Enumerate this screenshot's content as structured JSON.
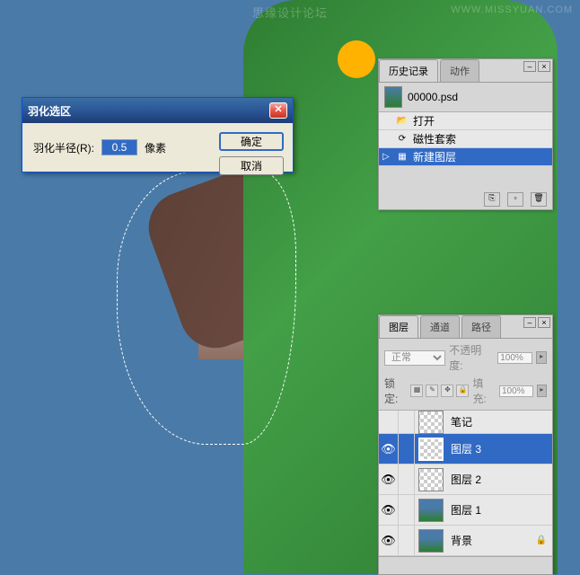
{
  "watermark": {
    "top": "思缘设计论坛",
    "right": "WWW.MISSYUAN.COM"
  },
  "dialog": {
    "title": "羽化选区",
    "label": "羽化半径(R):",
    "value": "0.5",
    "unit": "像素",
    "ok": "确定",
    "cancel": "取消"
  },
  "history": {
    "tab1": "历史记录",
    "tab2": "动作",
    "file": "00000.psd",
    "items": [
      {
        "icon": "📂",
        "label": "打开"
      },
      {
        "icon": "⟳",
        "label": "磁性套索"
      },
      {
        "icon": "▦",
        "label": "新建图层",
        "selected": true
      }
    ]
  },
  "layers": {
    "tab1": "图层",
    "tab2": "通道",
    "tab3": "路径",
    "blend_mode": "正常",
    "opacity_label": "不透明度:",
    "opacity_value": "100%",
    "lock_label": "锁定:",
    "fill_label": "填充:",
    "fill_value": "100%",
    "items": [
      {
        "name": "笔记",
        "visible": false,
        "thumb": "trans"
      },
      {
        "name": "图层 3",
        "visible": true,
        "thumb": "trans",
        "selected": true
      },
      {
        "name": "图层 2",
        "visible": true,
        "thumb": "trans"
      },
      {
        "name": "图层 1",
        "visible": true,
        "thumb": "bg"
      },
      {
        "name": "背景",
        "visible": true,
        "thumb": "bg",
        "locked": true
      }
    ]
  }
}
